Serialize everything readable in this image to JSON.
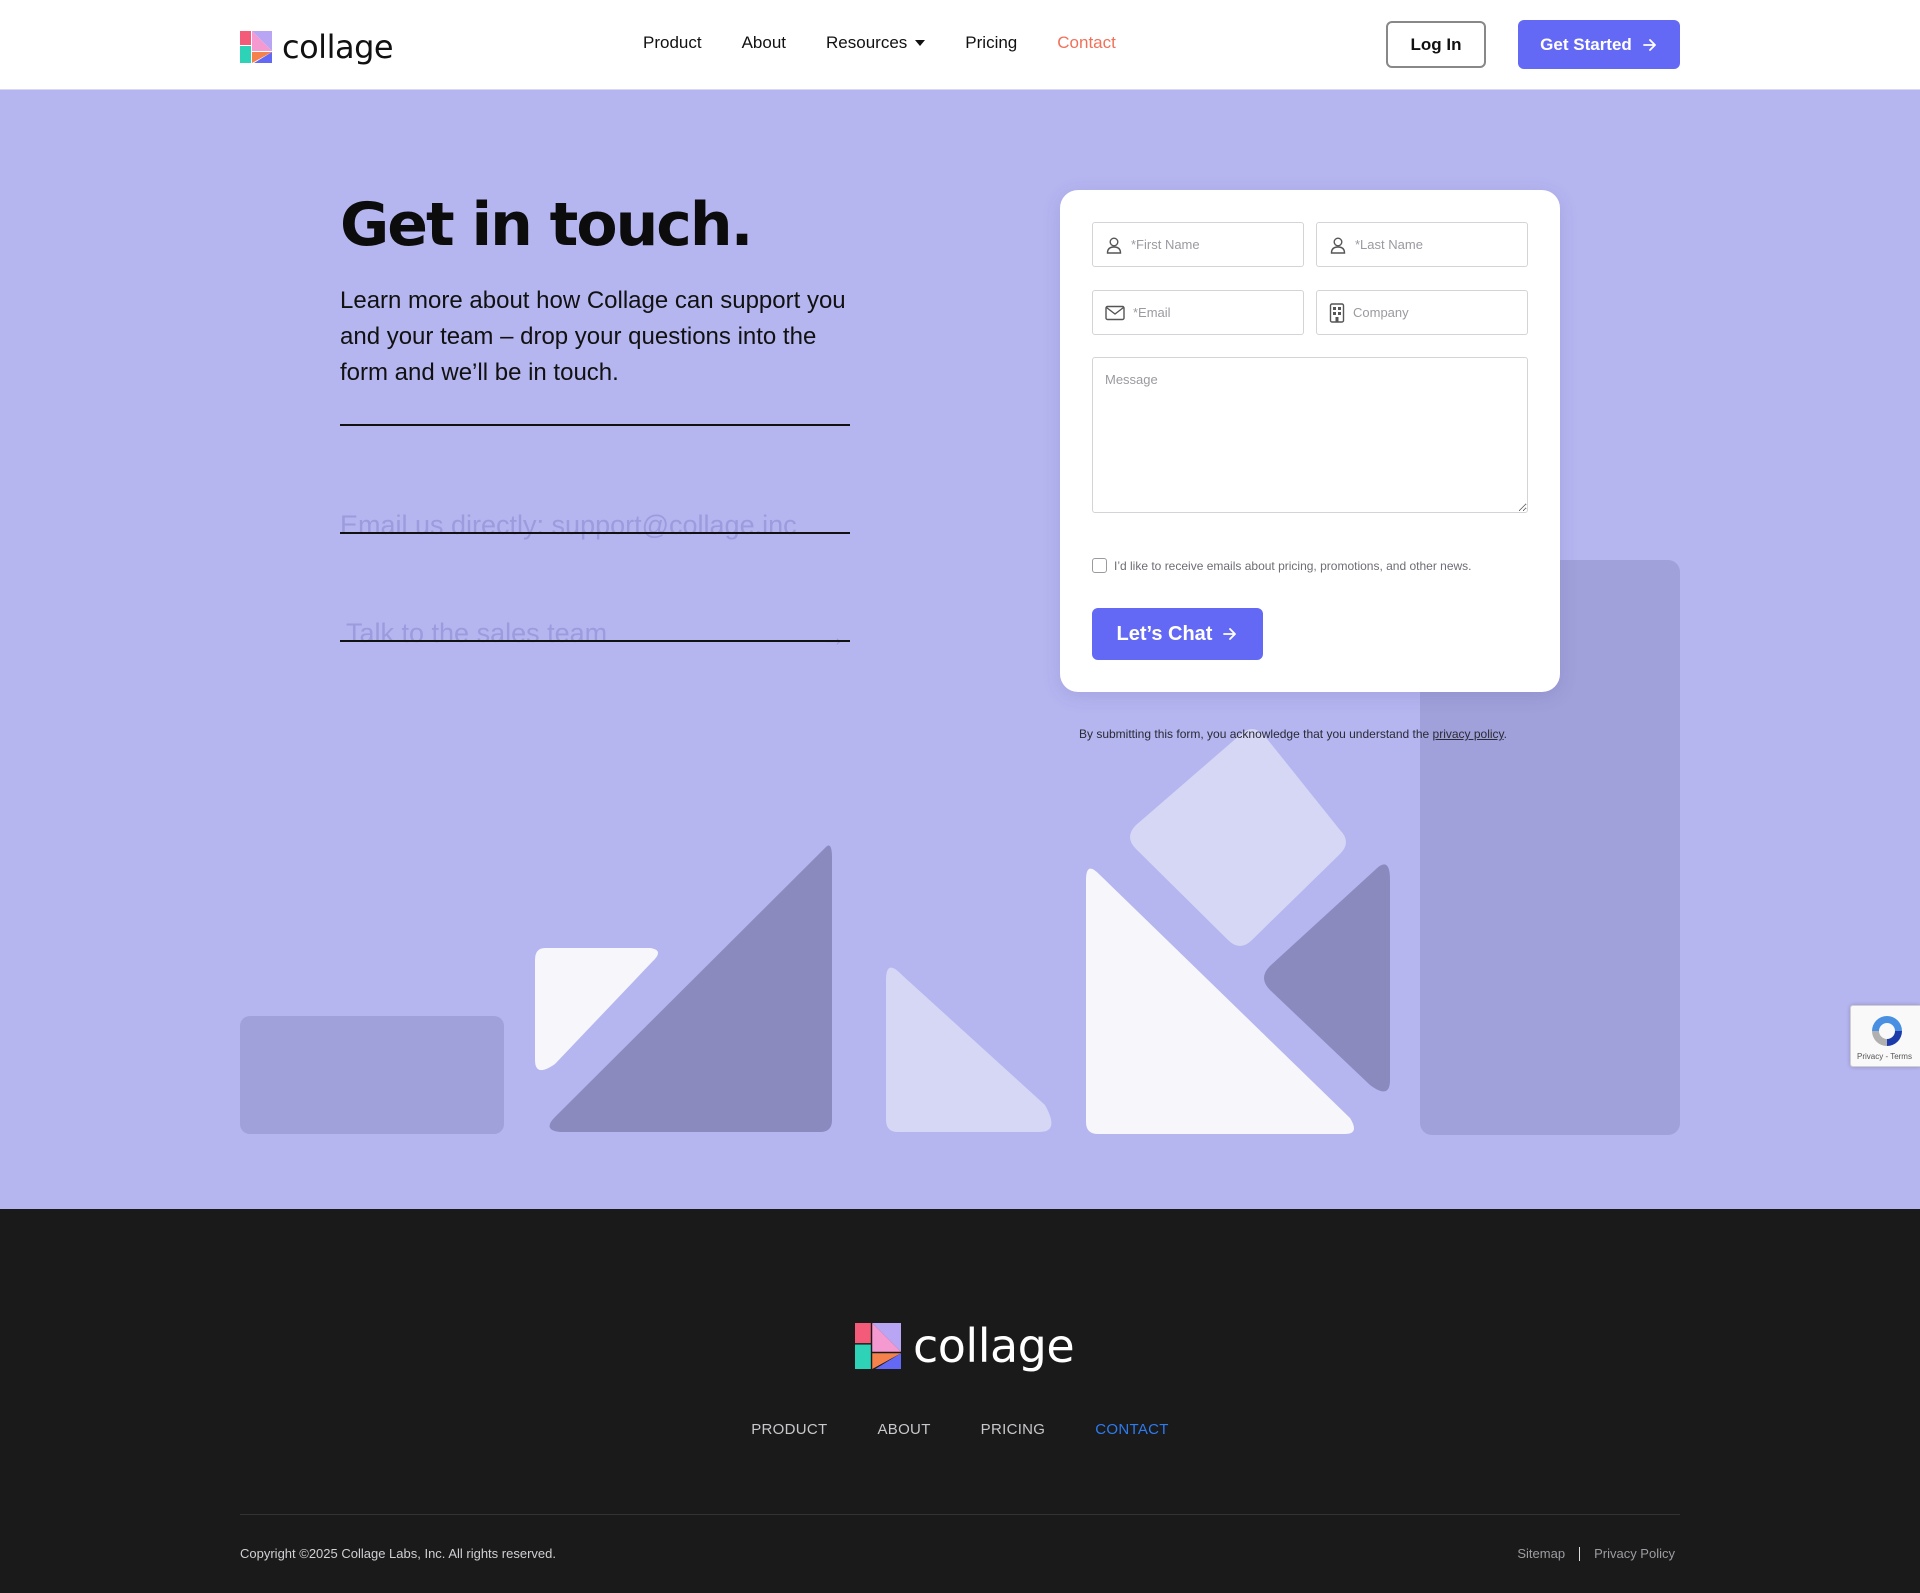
{
  "header": {
    "brand": "collage",
    "nav": [
      {
        "label": "Product"
      },
      {
        "label": "About"
      },
      {
        "label": "Resources"
      },
      {
        "label": "Pricing"
      },
      {
        "label": "Contact"
      }
    ],
    "login_label": "Log In",
    "get_started_label": "Get Started"
  },
  "hero": {
    "title": "Get in touch.",
    "subtitle": "Learn more about how Collage can support you and your team – drop your questions into the form and we’ll be in touch.",
    "email_link": "Email us directly: support@collage.inc",
    "sales_link": "Talk to the sales team",
    "sales_arrow": "→"
  },
  "form": {
    "first_name_placeholder": "*First Name",
    "last_name_placeholder": "*Last Name",
    "email_placeholder": "*Email",
    "company_placeholder": "Company",
    "message_placeholder": "Message",
    "consent_label": "I’d like to receive emails about pricing, promotions, and other news.",
    "submit_label": "Let’s Chat",
    "disclaimer_prefix": "By submitting this form, you acknowledge that you understand the ",
    "disclaimer_link": "privacy policy",
    "disclaimer_suffix": "."
  },
  "captcha": {
    "label": "Privacy - Terms"
  },
  "footer": {
    "brand": "collage",
    "nav": [
      {
        "label": "PRODUCT"
      },
      {
        "label": "ABOUT"
      },
      {
        "label": "PRICING"
      },
      {
        "label": "CONTACT"
      }
    ],
    "copyright": "Copyright ©2025 Collage Labs, Inc. All rights reserved.",
    "sitemap_label": "Sitemap",
    "privacy_label": "Privacy Policy"
  },
  "colors": {
    "accent": "#6469f5",
    "hero_bg": "#b5b5f0",
    "contact_active": "#f0715a",
    "footer_bg": "#1a1a1a",
    "footer_active": "#2d7bf0"
  }
}
